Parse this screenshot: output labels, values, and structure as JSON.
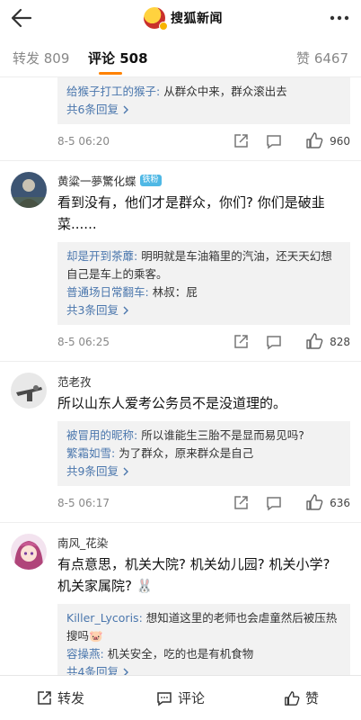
{
  "header": {
    "brand_name": "搜狐新闻",
    "back_icon": "back-arrow-icon",
    "more_icon": "more-dots-icon"
  },
  "tabs": [
    {
      "label": "转发 809"
    },
    {
      "label": "评论 508"
    },
    {
      "label": "赞 6467"
    }
  ],
  "accent_color": "#ff8200",
  "link_color": "#4b77ad",
  "comments": [
    {
      "replies": [
        {
          "nick": "给猴子打工的猴子",
          "text": "从群众中来，群众滚出去"
        }
      ],
      "more_replies": "共6条回复",
      "time": "8-5 06:20",
      "likes": "960"
    },
    {
      "user": "黄粱一夢驚化蝶",
      "badge": "铁粉",
      "text": "看到没有，他们才是群众，你们? 你们是破韭菜......",
      "replies": [
        {
          "nick": "却是开到茶蘼",
          "text": "明明就是车油箱里的汽油，还天天幻想自己是车上的乘客。"
        },
        {
          "nick": "普通场日常翻车",
          "text": "林叔：屁"
        }
      ],
      "more_replies": "共3条回复",
      "time": "8-5 06:25",
      "likes": "828"
    },
    {
      "user": "范老孜",
      "text": "所以山东人爱考公务员不是没道理的。",
      "replies": [
        {
          "nick": "被冒用的昵称",
          "text": "所以谁能生三胎不是显而易见吗?"
        },
        {
          "nick": "繁霜如雪",
          "text": "为了群众，原来群众是自己"
        }
      ],
      "more_replies": "共9条回复",
      "time": "8-5 06:17",
      "likes": "636"
    },
    {
      "user": "南风_花染",
      "text": "有点意思，机关大院? 机关幼儿园? 机关小学? 机关家属院? 🐰",
      "replies": [
        {
          "nick": "Killer_Lycoris",
          "text": "想知道这里的老师也会虐童然后被压热搜吗🐷"
        },
        {
          "nick": "容操燕",
          "text": "机关安全，吃的也是有机食物"
        }
      ],
      "more_replies": "共4条回复"
    }
  ],
  "bottom_bar": {
    "repost": "转发",
    "comment": "评论",
    "like": "赞"
  }
}
